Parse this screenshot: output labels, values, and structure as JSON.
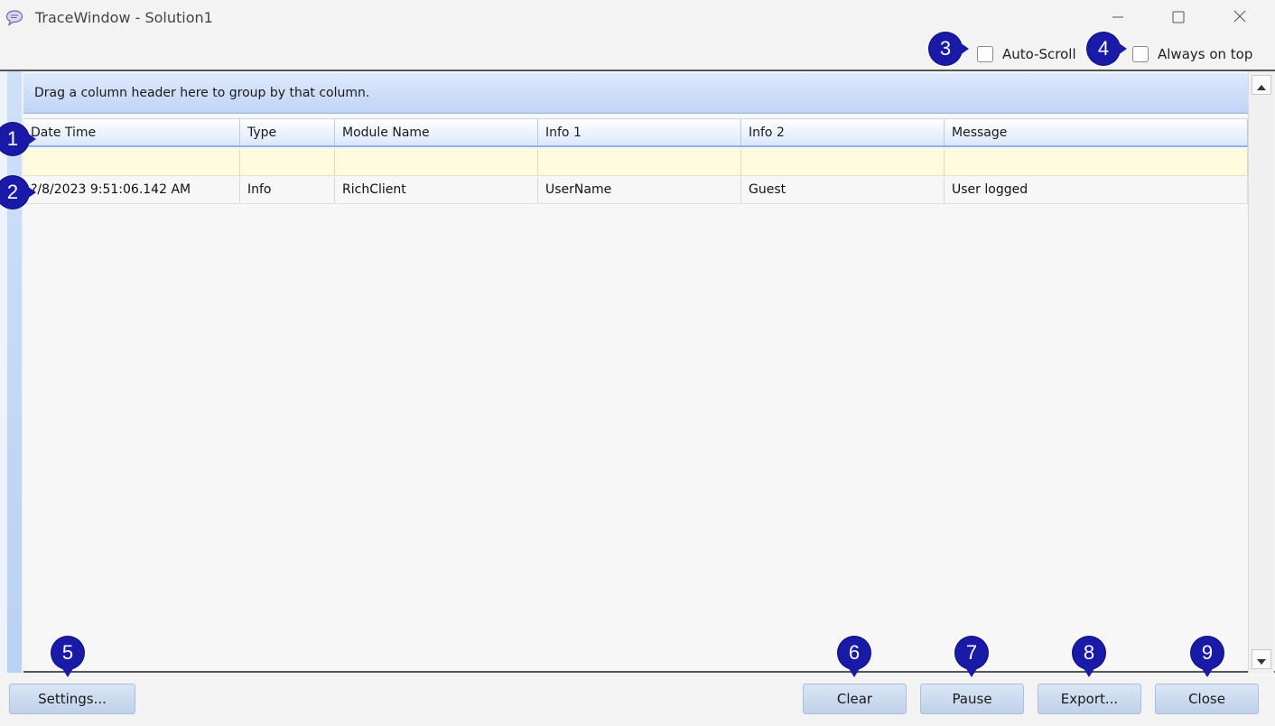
{
  "window": {
    "title": "TraceWindow - Solution1",
    "icons": {
      "app": "chat-bubble-icon",
      "minimize": "minimize-icon",
      "maximize": "maximize-icon",
      "close": "close-icon"
    }
  },
  "options": {
    "auto_scroll_label": "Auto-Scroll",
    "auto_scroll_checked": false,
    "always_on_top_label": "Always on top",
    "always_on_top_checked": false
  },
  "grid": {
    "group_panel_text": "Drag a column header here to group by that column.",
    "columns": [
      "Date Time",
      "Type",
      "Module Name",
      "Info 1",
      "Info 2",
      "Message"
    ],
    "rows": [
      [
        "?/8/2023 9:51:06.142 AM",
        "Info",
        "RichClient",
        "UserName",
        "Guest",
        "User logged"
      ]
    ]
  },
  "buttons": {
    "settings": "Settings...",
    "clear": "Clear",
    "pause": "Pause",
    "export": "Export...",
    "close": "Close"
  },
  "markers": [
    "1",
    "2",
    "3",
    "4",
    "5",
    "6",
    "7",
    "8",
    "9"
  ],
  "colors": {
    "marker": "#1a1aa8",
    "header_accent": "#8fb2e6",
    "filter_row": "#fffbdd"
  }
}
